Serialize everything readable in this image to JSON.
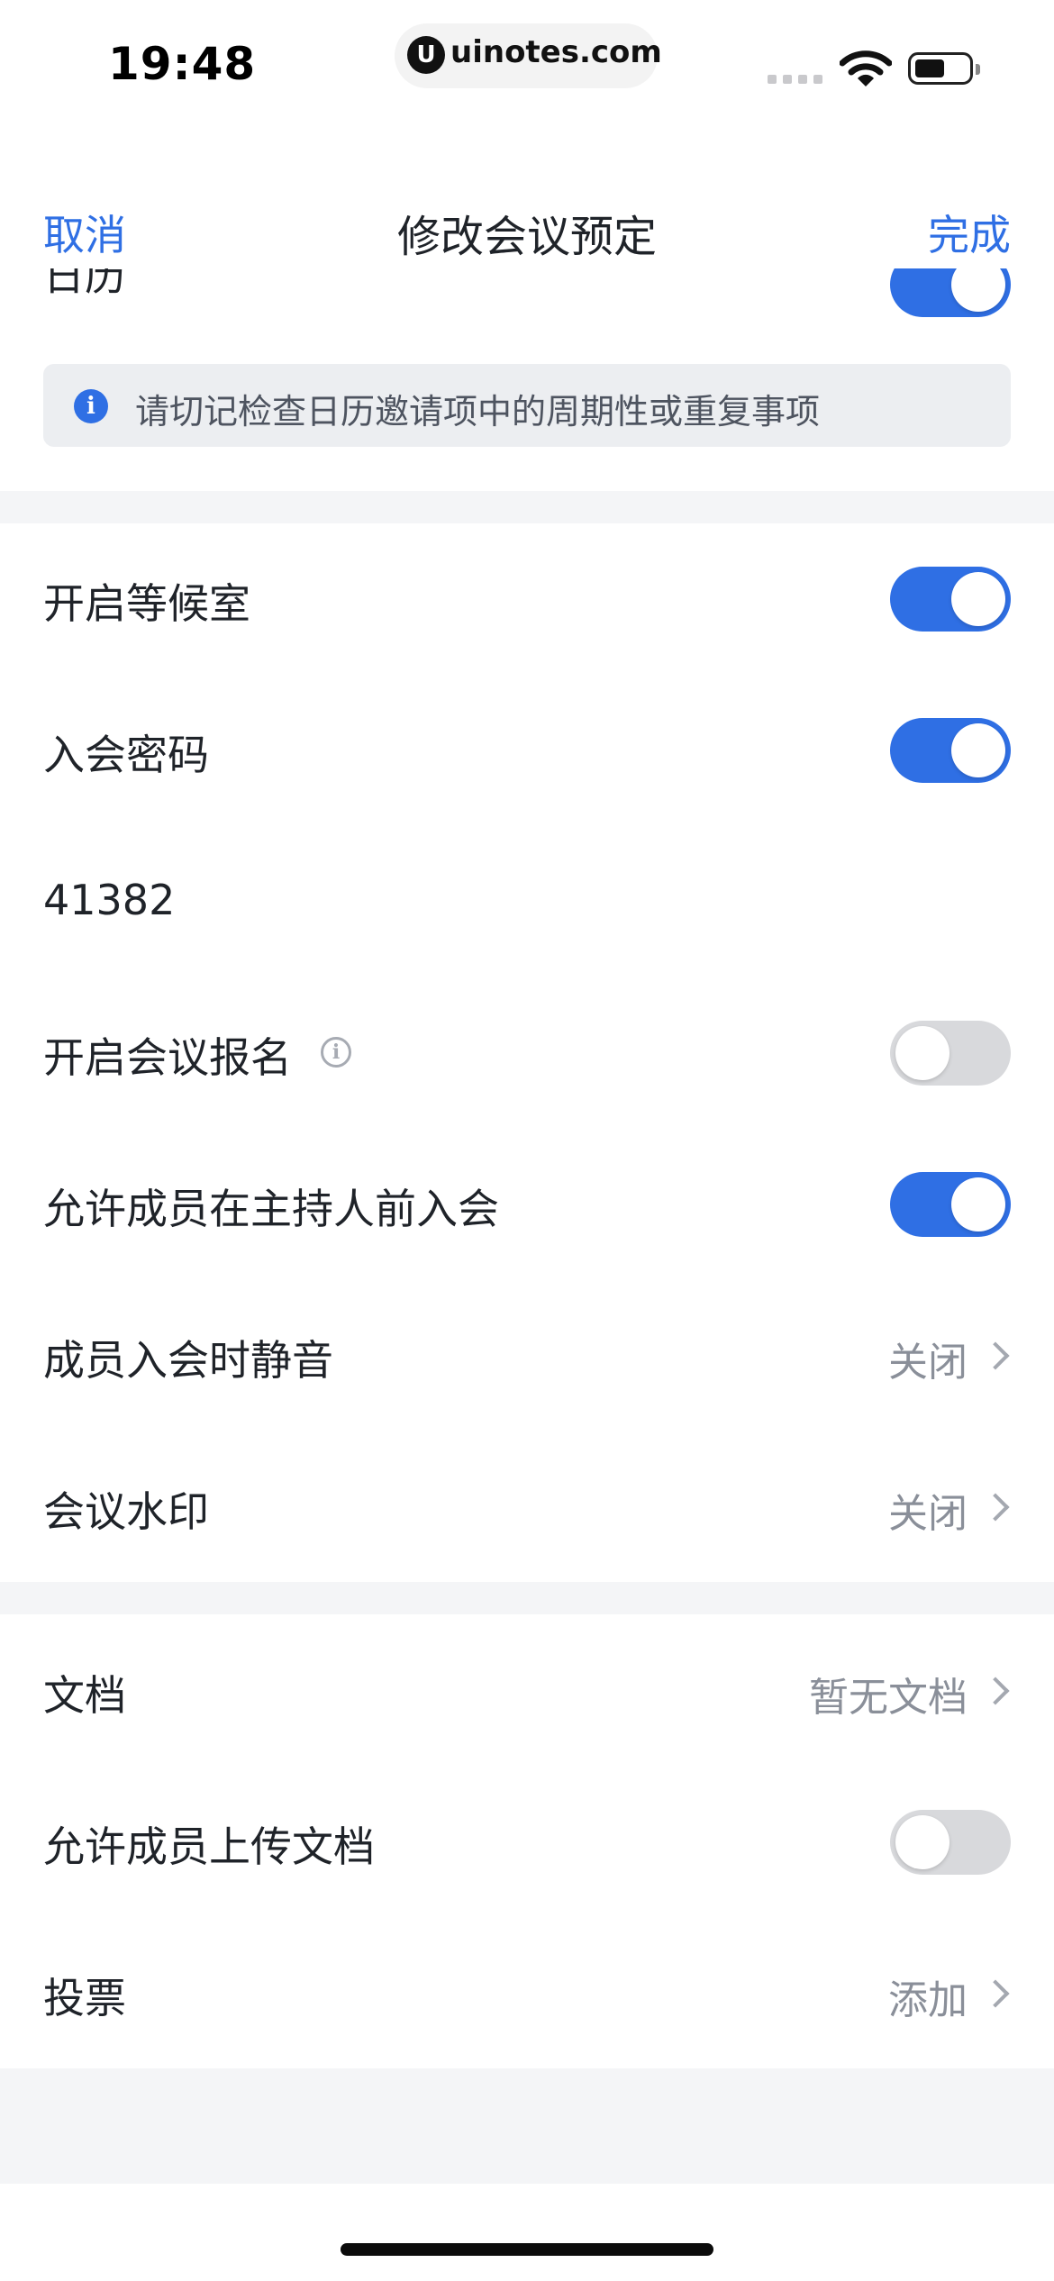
{
  "status_bar": {
    "time": "19:48",
    "url_icon": "U",
    "url": "uinotes.com"
  },
  "nav": {
    "cancel": "取消",
    "title": "修改会议预定",
    "done": "完成"
  },
  "partial_row": {
    "label": "日历",
    "toggle_on": true
  },
  "notice": {
    "icon": "i",
    "text": "请切记检查日历邀请项中的周期性或重复事项"
  },
  "settings": {
    "waiting_room": {
      "label": "开启等候室",
      "on": true
    },
    "password": {
      "label": "入会密码",
      "on": true,
      "value": "41382"
    },
    "registration": {
      "label": "开启会议报名",
      "info_icon": "i",
      "on": false
    },
    "join_before_host": {
      "label": "允许成员在主持人前入会",
      "on": true
    },
    "mute_on_join": {
      "label": "成员入会时静音",
      "value": "关闭"
    },
    "watermark": {
      "label": "会议水印",
      "value": "关闭"
    }
  },
  "docs": {
    "documents": {
      "label": "文档",
      "value": "暂无文档"
    },
    "allow_upload": {
      "label": "允许成员上传文档",
      "on": false
    },
    "vote": {
      "label": "投票",
      "value": "添加"
    }
  },
  "colors": {
    "accent": "#2f6fe4",
    "toggle_off": "#d8d9dc",
    "section_bg": "#f4f5f7",
    "notice_bg": "#eceef1"
  }
}
